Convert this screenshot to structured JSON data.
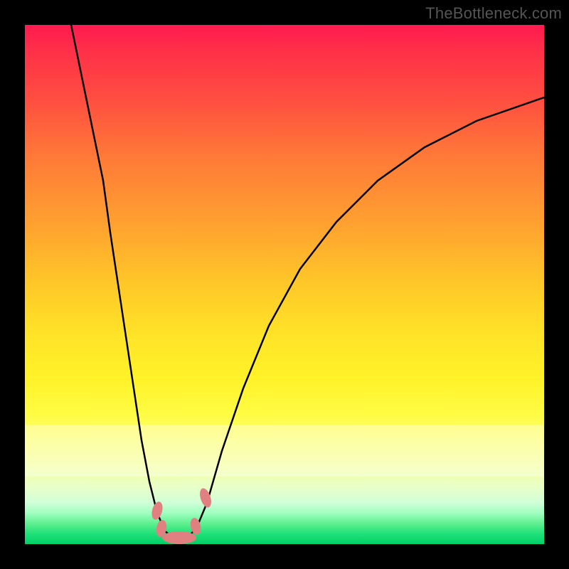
{
  "attribution": "TheBottleneck.com",
  "colors": {
    "frame": "#000000",
    "curve_stroke": "#000000",
    "blob_fill": "#e08080",
    "gradient_top": "#ff1a50",
    "gradient_bottom": "#00d068"
  },
  "chart_data": {
    "type": "line",
    "title": "",
    "subtitle": "",
    "xlabel": "",
    "ylabel": "",
    "x_range_pct": [
      0,
      100
    ],
    "y_range_pct": [
      0,
      100
    ],
    "note": "No axes, ticks, or labels are rendered; values below are percentages of the plot-area width (x) and height from bottom (y), estimated from the pixels.",
    "series": [
      {
        "name": "bottleneck-curve",
        "points": [
          {
            "x": 9.0,
            "y": 100.0
          },
          {
            "x": 11.0,
            "y": 90.0
          },
          {
            "x": 13.0,
            "y": 80.0
          },
          {
            "x": 15.0,
            "y": 70.0
          },
          {
            "x": 16.5,
            "y": 60.0
          },
          {
            "x": 18.0,
            "y": 50.0
          },
          {
            "x": 19.5,
            "y": 40.0
          },
          {
            "x": 21.0,
            "y": 30.0
          },
          {
            "x": 22.5,
            "y": 20.0
          },
          {
            "x": 24.0,
            "y": 12.0
          },
          {
            "x": 25.5,
            "y": 6.0
          },
          {
            "x": 27.0,
            "y": 2.5
          },
          {
            "x": 29.0,
            "y": 1.0
          },
          {
            "x": 31.0,
            "y": 1.0
          },
          {
            "x": 33.0,
            "y": 3.0
          },
          {
            "x": 35.0,
            "y": 8.0
          },
          {
            "x": 38.0,
            "y": 18.0
          },
          {
            "x": 42.0,
            "y": 30.0
          },
          {
            "x": 47.0,
            "y": 42.0
          },
          {
            "x": 53.0,
            "y": 53.0
          },
          {
            "x": 60.0,
            "y": 62.0
          },
          {
            "x": 68.0,
            "y": 70.0
          },
          {
            "x": 77.0,
            "y": 76.5
          },
          {
            "x": 87.0,
            "y": 81.5
          },
          {
            "x": 100.0,
            "y": 86.0
          }
        ]
      }
    ],
    "highlight_markers": [
      {
        "name": "left-shoulder-top",
        "x": 25.5,
        "y": 6.5,
        "size": "small"
      },
      {
        "name": "left-shoulder-bottom",
        "x": 26.2,
        "y": 3.0,
        "size": "small"
      },
      {
        "name": "valley-floor",
        "x": 29.5,
        "y": 1.2,
        "size": "wide"
      },
      {
        "name": "right-shoulder-bottom",
        "x": 32.8,
        "y": 3.5,
        "size": "small"
      },
      {
        "name": "right-shoulder-top",
        "x": 34.8,
        "y": 9.0,
        "size": "small"
      }
    ]
  }
}
